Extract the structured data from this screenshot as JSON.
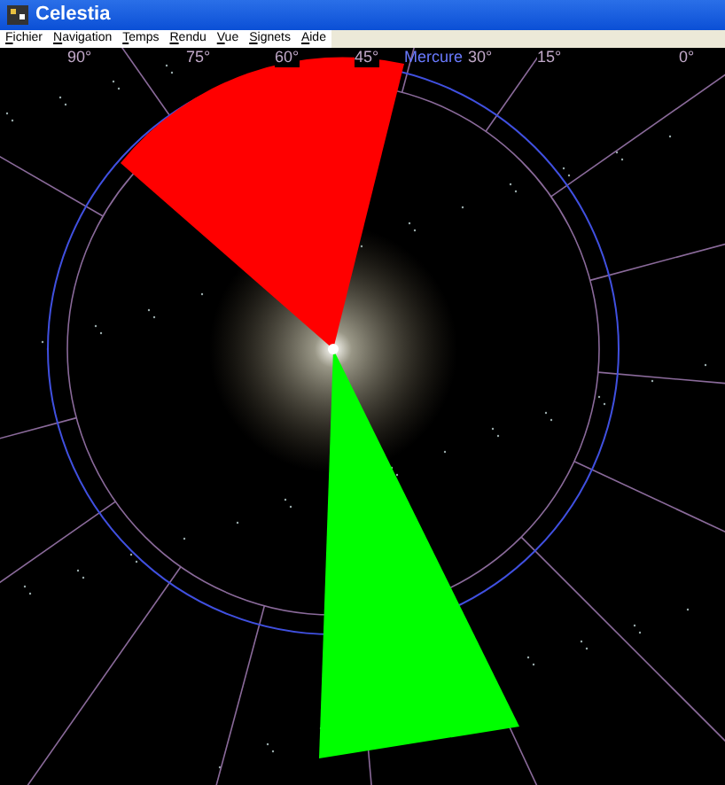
{
  "window": {
    "title": "Celestia"
  },
  "menu": [
    "Fichier",
    "Navigation",
    "Temps",
    "Rendu",
    "Vue",
    "Signets",
    "Aide"
  ],
  "sky_view": {
    "scale_labels": [
      "90°",
      "75°",
      "60°",
      "45°",
      "30°",
      "15°",
      "0°"
    ],
    "object_label": "Mercure"
  }
}
